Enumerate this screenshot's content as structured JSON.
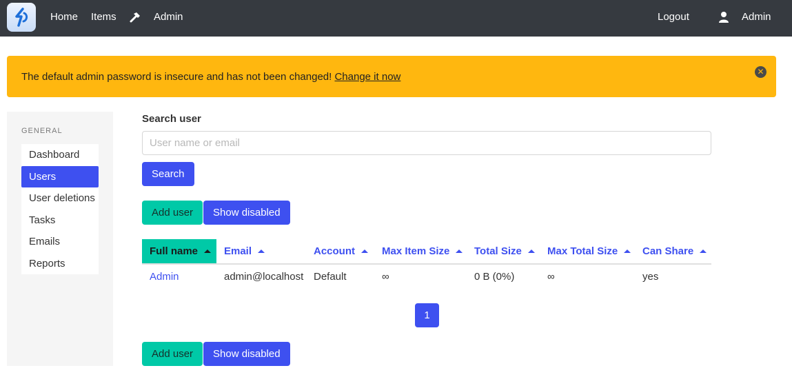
{
  "navbar": {
    "home_label": "Home",
    "items_label": "Items",
    "admin_label": "Admin",
    "logout_label": "Logout",
    "user_label": "Admin"
  },
  "banner": {
    "message": "The default admin password is insecure and has not been changed!",
    "link_label": "Change it now",
    "close_glyph": "✕"
  },
  "sidebar": {
    "section_title": "General",
    "items": [
      {
        "label": "Dashboard",
        "active": false
      },
      {
        "label": "Users",
        "active": true
      },
      {
        "label": "User deletions",
        "active": false
      },
      {
        "label": "Tasks",
        "active": false
      },
      {
        "label": "Emails",
        "active": false
      },
      {
        "label": "Reports",
        "active": false
      }
    ]
  },
  "search": {
    "label": "Search user",
    "placeholder": "User name or email",
    "value": "",
    "button_label": "Search"
  },
  "actions": {
    "add_user_label": "Add user",
    "show_disabled_label": "Show disabled"
  },
  "table": {
    "headers": [
      "Full name",
      "Email",
      "Account",
      "Max Item Size",
      "Total Size",
      "Max Total Size",
      "Can Share"
    ],
    "sorted_column": "Full name",
    "rows": [
      [
        "Admin",
        "admin@localhost",
        "Default",
        "∞",
        "0 B (0%)",
        "∞",
        "yes"
      ]
    ]
  },
  "pagination": {
    "current_page": "1"
  },
  "colors": {
    "navbar": "#363a40",
    "accent_blue": "#3e50f0",
    "accent_green": "#00c9a7",
    "warning": "#ffb70f"
  }
}
